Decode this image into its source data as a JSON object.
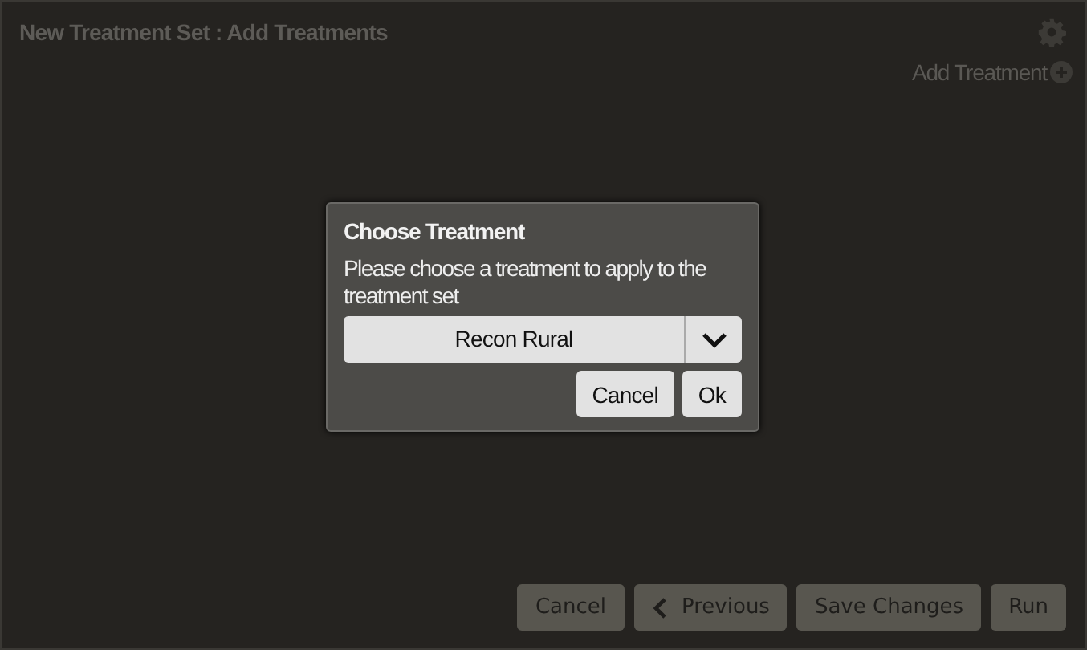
{
  "window": {
    "title": "New Treatment Set : Add Treatments"
  },
  "toolbar": {
    "add_label": "Add Treatment"
  },
  "dialog": {
    "title": "Choose Treatment",
    "message": "Please choose a treatment to apply to the treatment set",
    "dropdown": {
      "value": "Recon Rural"
    },
    "buttons": [
      {
        "label": "Cancel"
      },
      {
        "label": "Ok"
      }
    ]
  },
  "footer": {
    "buttons": [
      {
        "label": "Cancel",
        "kind": "plain"
      },
      {
        "label": "Previous",
        "kind": "back"
      },
      {
        "label": "Save Changes",
        "kind": "plain"
      },
      {
        "label": "Run",
        "kind": "plain"
      }
    ]
  }
}
